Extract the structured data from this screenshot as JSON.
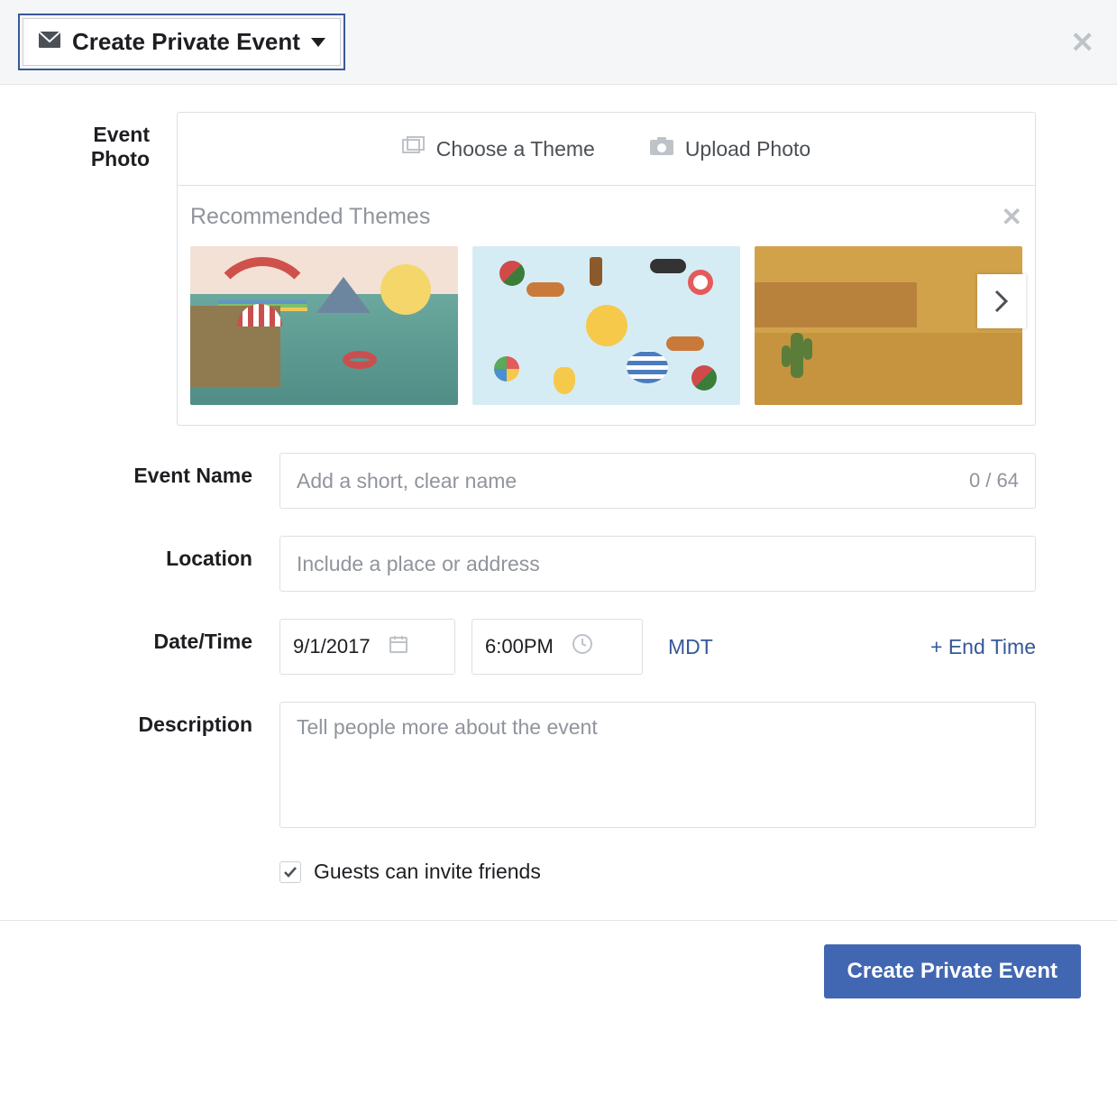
{
  "header": {
    "event_type_label": "Create Private Event"
  },
  "labels": {
    "event_photo": "Event Photo",
    "event_name": "Event Name",
    "location": "Location",
    "date_time": "Date/Time",
    "description": "Description"
  },
  "photo": {
    "choose_theme": "Choose a Theme",
    "upload_photo": "Upload Photo",
    "recommended_title": "Recommended Themes"
  },
  "event_name": {
    "placeholder": "Add a short, clear name",
    "counter": "0 / 64",
    "value": ""
  },
  "location": {
    "placeholder": "Include a place or address",
    "value": ""
  },
  "datetime": {
    "date": "9/1/2017",
    "time": "6:00PM",
    "timezone": "MDT",
    "end_time_label": "+ End Time"
  },
  "description": {
    "placeholder": "Tell people more about the event",
    "value": ""
  },
  "guests_invite": {
    "label": "Guests can invite friends",
    "checked": true
  },
  "footer": {
    "create_button": "Create Private Event"
  }
}
